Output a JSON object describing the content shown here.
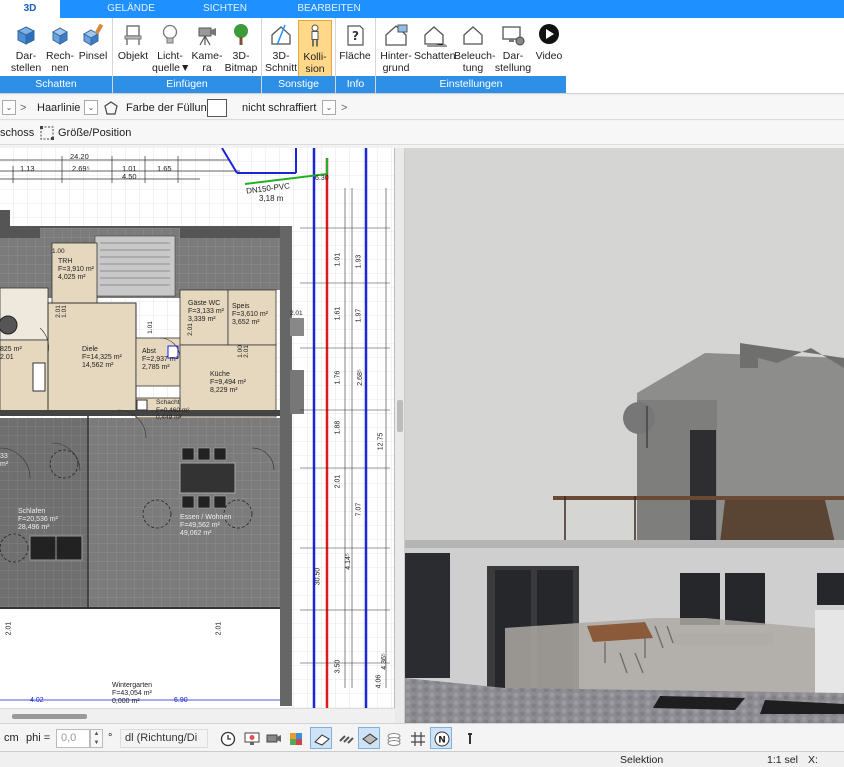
{
  "tabs": [
    "3D",
    "GELÄNDE",
    "SICHTEN",
    "BEARBEITEN"
  ],
  "ribbon": {
    "groups": [
      "Schatten",
      "Einfügen",
      "Sonstige",
      "Info",
      "Einstellungen"
    ],
    "buttons": [
      {
        "line1": "Dar-",
        "line2": "stellen",
        "icon": "render-cube-icon"
      },
      {
        "line1": "Rech-",
        "line2": "nen",
        "icon": "calc-cube-icon"
      },
      {
        "line1": "Pinsel",
        "line2": "",
        "icon": "brush-cube-icon"
      },
      {
        "line1": "Objekt",
        "line2": "",
        "icon": "chair-icon"
      },
      {
        "line1": "Licht-",
        "line2": "quelle▼",
        "icon": "lightbulb-icon"
      },
      {
        "line1": "Kame-",
        "line2": "ra",
        "icon": "camera-icon"
      },
      {
        "line1": "3D-",
        "line2": "Bitmap",
        "icon": "tree-icon"
      },
      {
        "line1": "3D-",
        "line2": "Schnitt",
        "icon": "section-house-icon"
      },
      {
        "line1": "Kolli-",
        "line2": "sion",
        "icon": "person-icon"
      },
      {
        "line1": "Fläche",
        "line2": "",
        "icon": "area-question-icon"
      },
      {
        "line1": "Hinter-",
        "line2": "grund",
        "icon": "background-house-icon"
      },
      {
        "line1": "Schatten",
        "line2": "",
        "icon": "shadow-house-icon"
      },
      {
        "line1": "Beleuch-",
        "line2": "tung",
        "icon": "lighting-house-icon"
      },
      {
        "line1": "Dar-",
        "line2": "stellung",
        "icon": "display-settings-icon"
      },
      {
        "line1": "Video",
        "line2": "",
        "icon": "play-icon"
      }
    ]
  },
  "propbar1": {
    "line_style": "Haarlinie",
    "fill_label": "Farbe der Füllung",
    "hatch": "nicht schraffiert"
  },
  "propbar2": {
    "floor": "schoss",
    "size_position": "Größe/Position"
  },
  "plan": {
    "dims_top": [
      "24.20",
      "1.13",
      "2.69⁵",
      "1.01",
      "4.50",
      "1.65"
    ],
    "pipe_label": "DN150-PVC",
    "pipe_length": "3,18 m",
    "pipe_dim": "6.30",
    "rooms": [
      {
        "name": "Diele",
        "area1": "F=14,325 m²",
        "area2": "14,562 m²"
      },
      {
        "name": "Gäste WC",
        "area1": "F=3,133 m²",
        "area2": "3,339 m²"
      },
      {
        "name": "Speis",
        "area1": "F=3,610 m²",
        "area2": "3,652 m²"
      },
      {
        "name": "Abst",
        "area1": "F=2,937 m²",
        "area2": "2,785 m²"
      },
      {
        "name": "Küche",
        "area1": "F=9,494 m²",
        "area2": "8,229 m²"
      },
      {
        "name": "Schacht",
        "area1": "F=0,460 m²",
        "area2": "0,449 m²"
      },
      {
        "name": "TRH",
        "area1": "F=3,910 m²",
        "area2": "4,025 m²"
      },
      {
        "name": "Schlafen",
        "area1": "F=20,536 m²",
        "area2": "28,496 m²"
      },
      {
        "name": "Essen / Wohnen",
        "area1": "F=49,562 m²",
        "area2": "49,062 m²"
      },
      {
        "name": "Wintergarten",
        "area1": "F=43,054 m²",
        "area2": "0,000 m²"
      }
    ],
    "partial_area": "825 m²",
    "partial_val": "2.01",
    "partial_left": "33",
    "partial_left2": "m²",
    "bottom_dims": [
      "4.02",
      "6.90"
    ],
    "dims_vertical": [
      "1.01",
      "1.61",
      "1.76",
      "1.88",
      "2.01",
      "30.50",
      "3.50",
      "1.93",
      "1.97",
      "2.68⁵",
      "12.75",
      "7.07",
      "4.14⁵",
      "4.36⁵",
      "4.06",
      "2.01",
      "2.01"
    ],
    "small_labels": [
      "1.00",
      "2.01",
      "1.01",
      "2.01",
      "1.00",
      "2.01",
      "1.01",
      "2.01"
    ]
  },
  "toolbar": {
    "unit": "cm",
    "phi_label": "phi =",
    "phi_value": "0,0",
    "deg": "°",
    "direction": "dl (Richtung/Di"
  },
  "status": {
    "mode": "Selektion",
    "scale": "1:1 sel",
    "x_label": "X:"
  },
  "colors": {
    "accent": "#1e90ff",
    "group_band": "#2e8fe6",
    "active_button": "#ffd88a",
    "pipe_blue": "#1a24d8",
    "pipe_red": "#e01818",
    "pipe_green": "#22b022"
  }
}
